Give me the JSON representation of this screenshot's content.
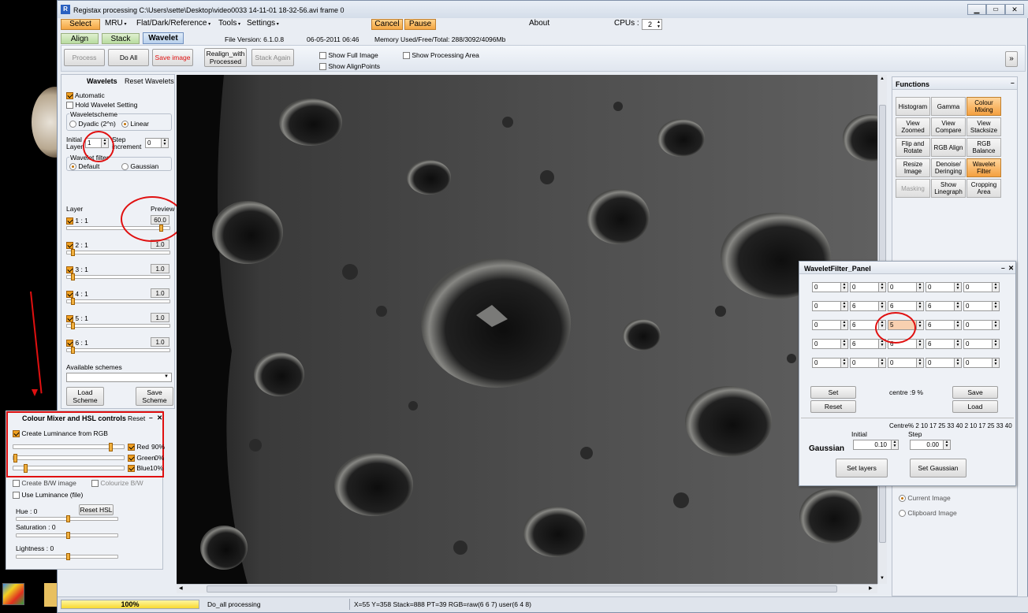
{
  "window": {
    "title": "Registax processing C:\\Users\\sette\\Desktop\\video0033 14-11-01 18-32-56.avi frame 0",
    "icon": "R"
  },
  "menu": {
    "select": "Select",
    "mru": "MRU",
    "flat": "Flat/Dark/Reference",
    "tools": "Tools",
    "settings": "Settings",
    "cancel": "Cancel",
    "pause": "Pause",
    "about": "About",
    "cpus_label": "CPUs :",
    "cpus_value": "2"
  },
  "tabs": {
    "align": "Align",
    "stack": "Stack",
    "wavelet": "Wavelet"
  },
  "info": {
    "version": "File Version: 6.1.0.8",
    "date": "06-05-2011 06:46",
    "memory": "Memory Used/Free/Total: 288/3092/4096Mb"
  },
  "toolbar": {
    "process": "Process",
    "do_all": "Do All",
    "save_image": "Save image",
    "realign_1": "Realign_with",
    "realign_2": "Processed",
    "stack_again": "Stack Again",
    "show_full": "Show Full Image",
    "show_align": "Show AlignPoints",
    "show_area": "Show Processing Area",
    "expand": "»"
  },
  "wavelets": {
    "title": "Wavelets",
    "reset": "Reset Wavelets",
    "automatic": "Automatic",
    "hold": "Hold Wavelet Setting",
    "scheme_title": "Waveletscheme",
    "dyadic": "Dyadic (2^n)",
    "linear": "Linear",
    "initial_1": "Initial",
    "initial_2": "Layer",
    "initial_val": "1",
    "step_1": "Step",
    "step_2": "increment",
    "step_val": "0",
    "filter_title": "Wavelet filter",
    "default": "Default",
    "gaussian": "Gaussian",
    "layer_hdr": "Layer",
    "preview_hdr": "Preview",
    "layers": [
      {
        "label": "1 : 1",
        "value": "60.0",
        "pos": 0.93
      },
      {
        "label": "2 : 1",
        "value": "1.0",
        "pos": 0.04
      },
      {
        "label": "3 : 1",
        "value": "1.0",
        "pos": 0.04
      },
      {
        "label": "4 : 1",
        "value": "1.0",
        "pos": 0.04
      },
      {
        "label": "5 : 1",
        "value": "1.0",
        "pos": 0.04
      },
      {
        "label": "6 : 1",
        "value": "1.0",
        "pos": 0.04
      }
    ],
    "available": "Available schemes",
    "load_1": "Load",
    "load_2": "Scheme",
    "save_1": "Save",
    "save_2": "Scheme"
  },
  "colour_mixer": {
    "title": "Colour Mixer and HSL controls",
    "reset": "Reset",
    "minimize": "–",
    "close": "✕",
    "create_lum": "Create Luminance from RGB",
    "red": "Red",
    "red_pct": "90%",
    "green": "Green",
    "green_pct": "0%",
    "blue": "Blue",
    "blue_pct": "10%",
    "red_level": 0.9,
    "green_level": 0.0,
    "blue_level": 0.1,
    "create_bw": "Create B/W image",
    "colorize": "Colourize B/W",
    "use_lum": "Use Luminance (file)",
    "hue": "Hue : 0",
    "reset_hsl": "Reset HSL",
    "saturation": "Saturation : 0",
    "lightness": "Lightness : 0"
  },
  "functions": {
    "title": "Functions",
    "buttons": [
      {
        "label": "Histogram",
        "active": false,
        "disabled": false
      },
      {
        "label": "Gamma",
        "active": false,
        "disabled": false
      },
      {
        "label": "Colour Mixing",
        "active": true,
        "disabled": false
      },
      {
        "label": "View Zoomed",
        "active": false,
        "disabled": false
      },
      {
        "label": "View Compare",
        "active": false,
        "disabled": false
      },
      {
        "label": "View Stacksize",
        "active": false,
        "disabled": false
      },
      {
        "label": "Flip and Rotate",
        "active": false,
        "disabled": false
      },
      {
        "label": "RGB Align",
        "active": false,
        "disabled": false
      },
      {
        "label": "RGB Balance",
        "active": false,
        "disabled": false
      },
      {
        "label": "Resize Image",
        "active": false,
        "disabled": false
      },
      {
        "label": "Denoise/ Deringing",
        "active": false,
        "disabled": false
      },
      {
        "label": "Wavelet Filter",
        "active": true,
        "disabled": false
      },
      {
        "label": "Masking",
        "active": false,
        "disabled": true
      },
      {
        "label": "Show Linegraph",
        "active": false,
        "disabled": false
      },
      {
        "label": "Cropping Area",
        "active": false,
        "disabled": false
      }
    ],
    "current_image": "Current Image",
    "clipboard_image": "Clipboard Image"
  },
  "wavelet_filter": {
    "title": "WaveletFilter_Panel",
    "grid": [
      [
        "0",
        "0",
        "0",
        "0",
        "0"
      ],
      [
        "0",
        "6",
        "6",
        "6",
        "0"
      ],
      [
        "0",
        "6",
        "5",
        "6",
        "0"
      ],
      [
        "0",
        "6",
        "6",
        "6",
        "0"
      ],
      [
        "0",
        "0",
        "0",
        "0",
        "0"
      ]
    ],
    "set": "Set",
    "reset": "Reset",
    "centre": "centre :9 %",
    "save": "Save",
    "load": "Load",
    "centre_pct": "Centre%  2 10 17 25 33 40  2 10 17 25 33 40",
    "gaussian": "Gaussian",
    "initial": "Initial",
    "initial_val": "0.10",
    "step": "Step",
    "step_val": "0.00",
    "set_layers": "Set layers",
    "set_gaussian": "Set Gaussian"
  },
  "status": {
    "progress": "100%",
    "progress_level": 1.0,
    "message": "Do_all processing",
    "coords": "X=55 Y=358 Stack=888 PT=39 RGB=raw(6 6 7) user(6 4 8)"
  },
  "colors": {
    "accent": "#f0a020",
    "chrome": "#e8ecf2",
    "red_mark": "#e01010"
  }
}
